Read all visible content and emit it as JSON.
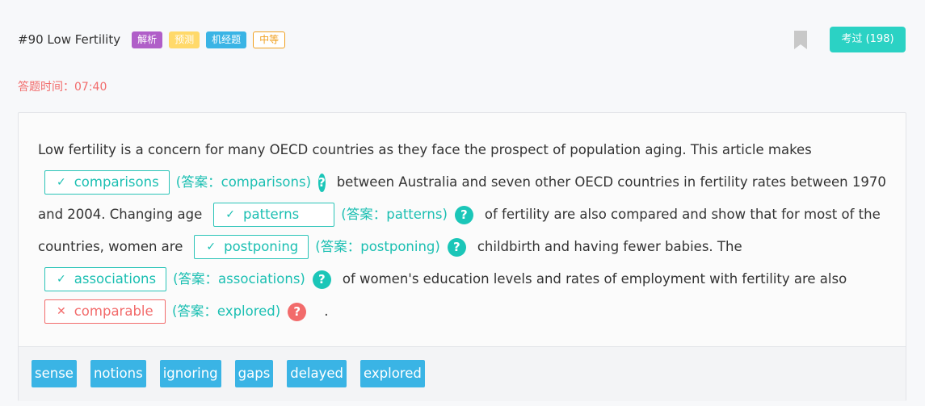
{
  "header": {
    "title": "#90 Low Fertility",
    "tags": [
      "解析",
      "预测",
      "机经题",
      "中等"
    ],
    "exam_button": "考过 (198)"
  },
  "timer": "答题时间：07:40",
  "passage": {
    "l1_text": "Low fertility is a concern for many OECD countries as they face the prospect of population aging. This article makes",
    "l2_after": "between Australia and seven other OECD countries in fertility rates between 1970",
    "l3_before": "and 2004. Changing age",
    "l3_after": "of fertility are also compared and show that for most of the",
    "l4_before": "countries, women are",
    "l4_after": "childbirth and having fewer babies. The",
    "l5_after": "of women's education levels and rates of employment with fertility are also",
    "l6_after": "."
  },
  "blanks": [
    {
      "value": "comparisons",
      "answer": "(答案：comparisons)",
      "status": "correct",
      "mark": "✓"
    },
    {
      "value": "patterns",
      "answer": "(答案：patterns)",
      "status": "correct",
      "mark": "✓"
    },
    {
      "value": "postponing",
      "answer": "(答案：postponing)",
      "status": "correct",
      "mark": "✓"
    },
    {
      "value": "associations",
      "answer": "(答案：associations)",
      "status": "correct",
      "mark": "✓"
    },
    {
      "value": "comparable",
      "answer": "(答案：explored)",
      "status": "wrong",
      "mark": "✕"
    }
  ],
  "help_icon": "?",
  "options": [
    "sense",
    "notions",
    "ignoring",
    "gaps",
    "delayed",
    "explored"
  ],
  "colors": {
    "accent": "#2bd2c4",
    "error": "#f26b6b",
    "option": "#3ab4e5"
  }
}
